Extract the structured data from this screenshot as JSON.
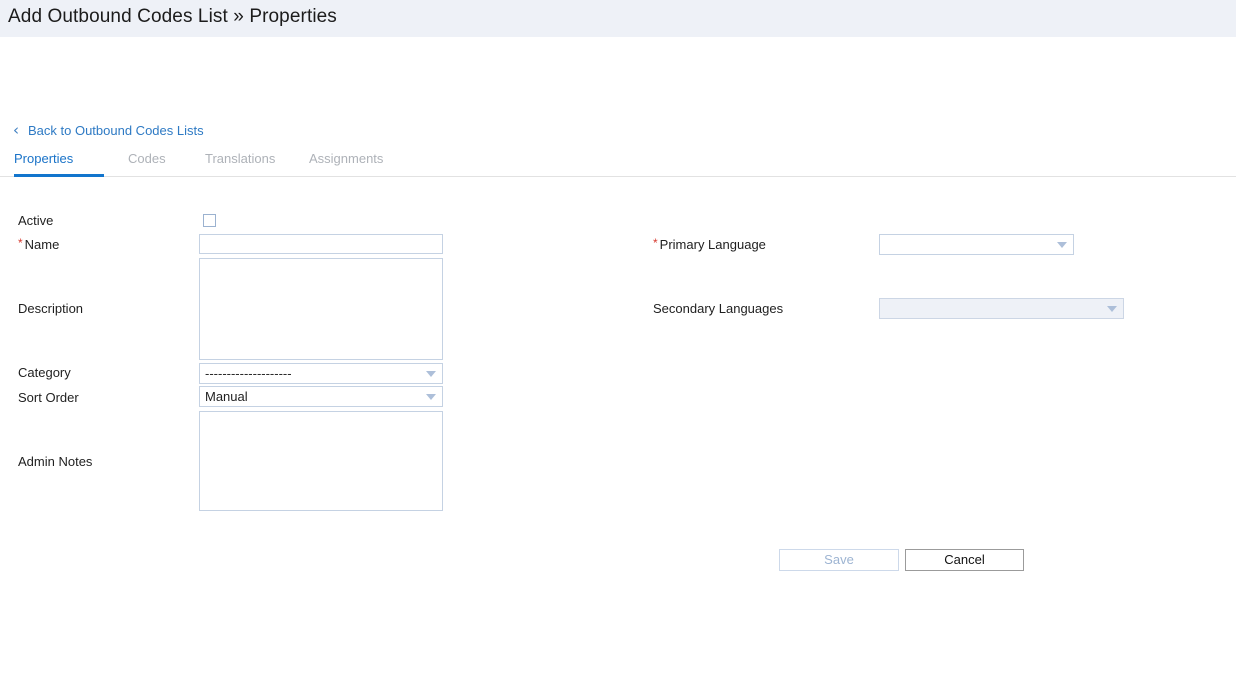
{
  "header": {
    "title": "Add Outbound Codes List » Properties"
  },
  "back_link": {
    "icon": "chevron-left-icon",
    "label": "Back to Outbound Codes Lists"
  },
  "tabs": [
    {
      "label": "Properties",
      "active": true
    },
    {
      "label": "Codes",
      "active": false
    },
    {
      "label": "Translations",
      "active": false
    },
    {
      "label": "Assignments",
      "active": false
    }
  ],
  "form": {
    "left": {
      "active": {
        "label": "Active",
        "checked": false
      },
      "name": {
        "label": "Name",
        "required_marker": "*",
        "value": "",
        "placeholder": ""
      },
      "description": {
        "label": "Description",
        "value": "",
        "placeholder": ""
      },
      "category": {
        "label": "Category",
        "value": "--------------------"
      },
      "sort_order": {
        "label": "Sort Order",
        "value": "Manual"
      },
      "admin_notes": {
        "label": "Admin Notes",
        "value": "",
        "placeholder": ""
      }
    },
    "right": {
      "primary_language": {
        "label": "Primary Language",
        "required_marker": "*",
        "value": ""
      },
      "secondary_languages": {
        "label": "Secondary Languages",
        "value": "",
        "disabled": true
      }
    }
  },
  "buttons": {
    "save": {
      "label": "Save",
      "disabled": true
    },
    "cancel": {
      "label": "Cancel",
      "disabled": false
    }
  },
  "colors": {
    "header_bg": "#eef1f7",
    "link_blue": "#2e7ac4",
    "tab_active_blue": "#1a73c8",
    "tab_underline": "#1275cd",
    "tab_inactive": "#aeb2b8",
    "required_red": "#d63a2f",
    "field_border": "#c5d2e3",
    "disabled_fill": "#eef1f7",
    "arrow": "#adbfd9"
  }
}
